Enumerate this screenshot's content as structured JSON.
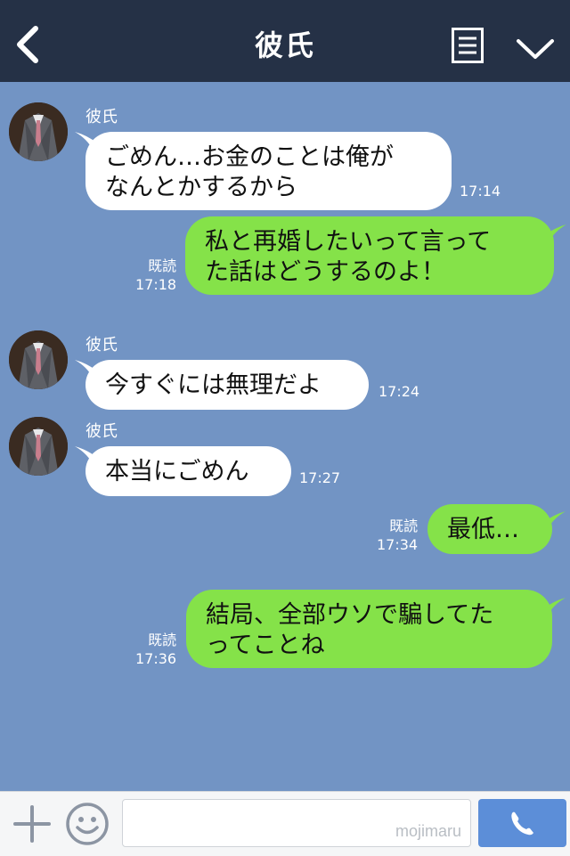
{
  "header": {
    "title": "彼氏"
  },
  "messages": [
    {
      "sender": "彼氏",
      "line1": "ごめん…お金のことは俺が",
      "line2": "なんとかするから",
      "time": "17:14"
    },
    {
      "read": "既読",
      "line1": "私と再婚したいって言って",
      "line2": "た話はどうするのよ！",
      "time": "17:18"
    },
    {
      "sender": "彼氏",
      "line1": "今すぐには無理だよ",
      "time": "17:24"
    },
    {
      "sender": "彼氏",
      "line1": "本当にごめん",
      "time": "17:27"
    },
    {
      "read": "既読",
      "line1": "最低…",
      "time": "17:34"
    },
    {
      "read": "既読",
      "line1": "結局、全部ウソで騙してた",
      "line2": "ってことね",
      "time": "17:36"
    }
  ],
  "input": {
    "watermark": "mojimaru"
  },
  "colors": {
    "header": "#253146",
    "background": "#7294c4",
    "outgoing": "#85e249",
    "incoming": "#ffffff",
    "call": "#5c8ed8"
  }
}
